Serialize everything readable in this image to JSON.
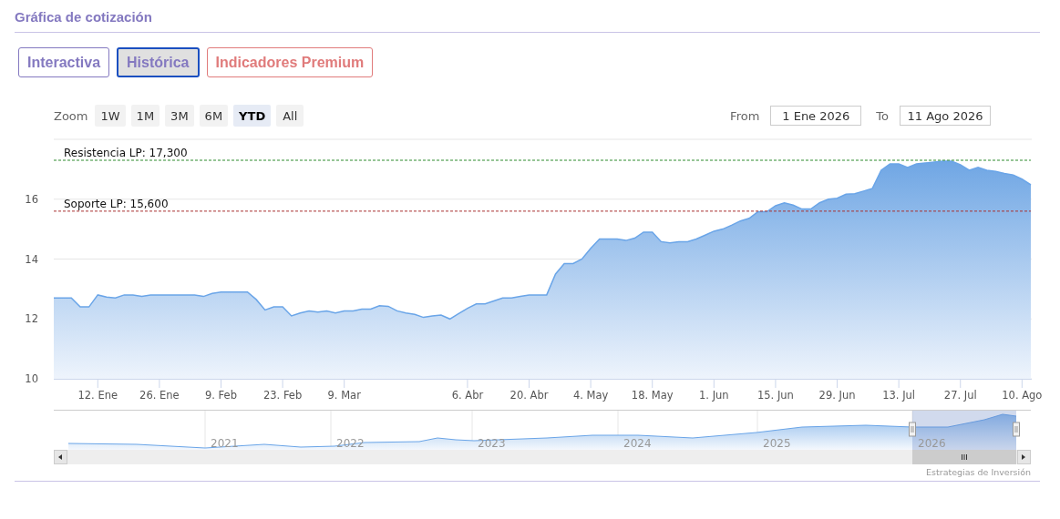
{
  "section": {
    "title": "Gráfica de cotización"
  },
  "tabs": [
    {
      "label": "Interactiva",
      "selected": false,
      "kind": "normal"
    },
    {
      "label": "Histórica",
      "selected": true,
      "kind": "normal"
    },
    {
      "label": "Indicadores Premium",
      "selected": false,
      "kind": "premium"
    }
  ],
  "range_selector": {
    "label": "Zoom",
    "buttons": [
      {
        "label": "1W",
        "selected": false
      },
      {
        "label": "1M",
        "selected": false
      },
      {
        "label": "3M",
        "selected": false
      },
      {
        "label": "6M",
        "selected": false
      },
      {
        "label": "YTD",
        "selected": true
      },
      {
        "label": "All",
        "selected": false
      }
    ],
    "from_label": "From",
    "from_value": "1 Ene 2026",
    "to_label": "To",
    "to_value": "11 Ago 2026"
  },
  "chart": {
    "chart_data": {
      "type": "area",
      "grid": true,
      "ylim": [
        10,
        18
      ],
      "yticks": [
        10,
        12,
        14,
        16
      ],
      "categories": [
        null,
        null,
        null,
        null,
        null,
        "12. Ene",
        null,
        null,
        null,
        null,
        null,
        null,
        "26. Ene",
        null,
        null,
        null,
        null,
        null,
        null,
        "9. Feb",
        null,
        null,
        null,
        null,
        null,
        null,
        "23. Feb",
        null,
        null,
        null,
        null,
        null,
        null,
        "9. Mar",
        null,
        null,
        null,
        null,
        null,
        null,
        null,
        null,
        null,
        null,
        null,
        null,
        null,
        "6. Abr",
        null,
        null,
        null,
        null,
        null,
        null,
        "20. Abr",
        null,
        null,
        null,
        null,
        null,
        null,
        "4. May",
        null,
        null,
        null,
        null,
        null,
        null,
        "18. May",
        null,
        null,
        null,
        null,
        null,
        null,
        "1. Jun",
        null,
        null,
        null,
        null,
        null,
        null,
        "15. Jun",
        null,
        null,
        null,
        null,
        null,
        null,
        "29. Jun",
        null,
        null,
        null,
        null,
        null,
        null,
        "13. Jul",
        null,
        null,
        null,
        null,
        null,
        null,
        "27. Jul",
        null,
        null,
        null,
        null,
        null,
        null,
        "10. Ago",
        null
      ],
      "series": [
        {
          "color": "#6aa5e8",
          "values": [
            12.7,
            12.7,
            12.7,
            12.4,
            12.4,
            12.8,
            12.73,
            12.7,
            12.8,
            12.8,
            12.75,
            12.8,
            12.8,
            12.8,
            12.8,
            12.8,
            12.8,
            12.75,
            12.85,
            12.9,
            12.9,
            12.9,
            12.9,
            12.65,
            12.3,
            12.4,
            12.4,
            12.1,
            12.2,
            12.27,
            12.23,
            12.27,
            12.2,
            12.27,
            12.27,
            12.33,
            12.33,
            12.44,
            12.42,
            12.27,
            12.2,
            12.15,
            12.05,
            12.1,
            12.13,
            12.0,
            12.18,
            12.35,
            12.5,
            12.5,
            12.6,
            12.7,
            12.7,
            12.75,
            12.8,
            12.8,
            12.8,
            13.5,
            13.85,
            13.85,
            14.0,
            14.36,
            14.67,
            14.67,
            14.67,
            14.62,
            14.7,
            14.9,
            14.9,
            14.58,
            14.54,
            14.58,
            14.58,
            14.67,
            14.8,
            14.93,
            15.0,
            15.13,
            15.27,
            15.36,
            15.58,
            15.58,
            15.78,
            15.88,
            15.8,
            15.67,
            15.67,
            15.88,
            16.0,
            16.03,
            16.17,
            16.18,
            16.27,
            16.36,
            16.97,
            17.18,
            17.18,
            17.06,
            17.18,
            17.21,
            17.24,
            17.27,
            17.27,
            17.15,
            16.97,
            17.06,
            16.97,
            16.93,
            16.86,
            16.81,
            16.67,
            16.48
          ]
        }
      ],
      "ref_lines": [
        {
          "axis": "y",
          "label": "Resistencia LP: 17,300",
          "value": 17.3,
          "color": "#2e8b2e"
        },
        {
          "axis": "y",
          "label": "Soporte LP: 15,600",
          "value": 15.6,
          "color": "#a83232"
        }
      ]
    }
  },
  "navigator": {
    "years": [
      "2021",
      "2022",
      "2023",
      "2024",
      "2025",
      "2026"
    ]
  },
  "credits": "Estrategias de Inversión"
}
